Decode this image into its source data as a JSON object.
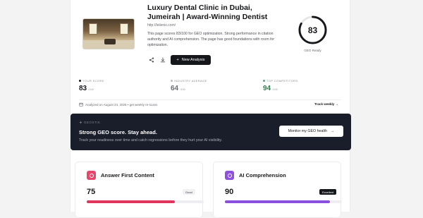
{
  "header": {
    "title": "Luxury Dental Clinic in Dubai, Jumeirah | Award-Winning Dentist",
    "url": "http://leilenix.com/",
    "summary": "This page scores 83/100 for GEO optimization. Strong performance in citation authority and AI comprehension. The page has good foundations with room for optimization.",
    "new_analysis_label": "New Analysis",
    "share_icon": "share-icon",
    "download_icon": "download-icon"
  },
  "score_ring": {
    "value": "83",
    "label": "GEO Ready",
    "fraction": 0.83,
    "color": "#16171a"
  },
  "stats": [
    {
      "label": "YOUR SCORE",
      "value": "83",
      "max": "/100",
      "color": "#16171a",
      "dot": "#16171a"
    },
    {
      "label": "INDUSTRY AVERAGE",
      "value": "64",
      "max": "/100",
      "color": "#6a6c72",
      "dot": "#b8bac0"
    },
    {
      "label": "TOP COMPETITORS",
      "value": "94",
      "max": "/100",
      "color": "#2f7a4f",
      "dot": "#4fae7a"
    }
  ],
  "analyzed_text": "Analyzed on August 24, 2026 • get weekly re-scans",
  "track_label": "Track weekly",
  "banner": {
    "brand": "GEOSTIK",
    "headline": "Strong GEO score. Stay ahead.",
    "subtext": "Track your readiness over time and catch regressions before they hurt your AI visibility.",
    "button_label": "Monitor my GEO health",
    "background": "#1a1e2a"
  },
  "cards": [
    {
      "name": "Answer First Content",
      "score": "75",
      "fraction": 0.75,
      "badge": "Good",
      "icon_color": "#e8466c",
      "bar_color": "#e0355c",
      "badge_bg": "#f1f1f3",
      "badge_fg": "#3a3c42"
    },
    {
      "name": "AI Comprehension",
      "score": "90",
      "fraction": 0.9,
      "badge": "Excellent",
      "icon_color": "#8f4fe0",
      "bar_color": "#8a4fdc",
      "badge_bg": "#16171a",
      "badge_fg": "#ffffff"
    }
  ]
}
